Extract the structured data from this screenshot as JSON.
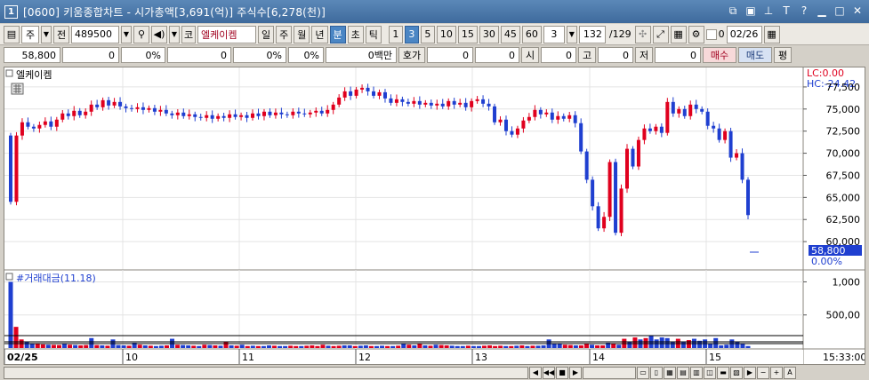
{
  "window": {
    "window_number": "1",
    "title": "[0600] 키움종합차트 - 시가총액[3,691(억)] 주식수[6,278(천)]"
  },
  "toolbar": {
    "period_select": "주",
    "prev_label": "전",
    "stock_code": "489500",
    "market_label": "코",
    "stock_name": "엘케이켐",
    "tf_day": "일",
    "tf_week": "주",
    "tf_month": "월",
    "tf_year": "년",
    "tf_minute": "분",
    "tf_second": "초",
    "tf_tick": "틱",
    "intervals": [
      "1",
      "3",
      "5",
      "10",
      "15",
      "30",
      "45",
      "60"
    ],
    "interval_value": "3",
    "bar_count": "132",
    "bar_total": "/129",
    "checkbox_count": "0",
    "date_value": "02/26"
  },
  "info": {
    "price": "58,800",
    "change": "0",
    "change_pct": "0%",
    "volume": "0",
    "volume_pct": "0%",
    "pct3": "0%",
    "amount": "0백만",
    "quote_label": "호가",
    "quote_bid": "0",
    "quote_ask": "0",
    "open_label": "시",
    "open": "0",
    "high_label": "고",
    "high": "0",
    "low_label": "저",
    "low": "0",
    "buy_label": "매수",
    "sell_label": "매도",
    "avg_label": "평"
  },
  "chart_title": "엘케이켐",
  "lc_label": "LC:0.00",
  "hc_label": "HC:-24.42",
  "current_price_tag": "58,800",
  "current_pct_tag": "0.00%",
  "volume_title": "#거래대금(11.18)",
  "time_label": "15:33:00",
  "colors": {
    "up": "#e0001e",
    "down": "#1f3fd0",
    "price_tag": "#1f3fd0"
  },
  "chart_data": {
    "type": "candlestick",
    "price_axis": {
      "ticks": [
        77500,
        75000,
        72500,
        70000,
        67500,
        65000,
        62500,
        60000
      ],
      "labels": [
        "77,500",
        "75,000",
        "72,500",
        "70,000",
        "67,500",
        "65,000",
        "62,500",
        "60,000"
      ],
      "range": [
        57000,
        79500
      ]
    },
    "volume_axis": {
      "ticks": [
        1000,
        500
      ],
      "labels": [
        "1,000",
        "500,00"
      ],
      "range": [
        0,
        1100
      ]
    },
    "date_labels": [
      "02/25",
      "10",
      "11",
      "12",
      "13",
      "14",
      "15"
    ],
    "volume_bars": [
      1000,
      320,
      130,
      100,
      70,
      60,
      55,
      50,
      48,
      45,
      60,
      50,
      45,
      40,
      45,
      150,
      45,
      40,
      35,
      130,
      45,
      40,
      35,
      80,
      50,
      40,
      35,
      30,
      35,
      40,
      140,
      50,
      45,
      40,
      35,
      30,
      50,
      45,
      40,
      35,
      100,
      40,
      35,
      50,
      30,
      35,
      30,
      30,
      40,
      35,
      30,
      30,
      35,
      30,
      30,
      35,
      40,
      30,
      50,
      35,
      30,
      35,
      40,
      40,
      30,
      35,
      40,
      30,
      30,
      35,
      30,
      30,
      35,
      70,
      50,
      40,
      60,
      40,
      35,
      50,
      45,
      40,
      35,
      30,
      30,
      35,
      30,
      30,
      35,
      40,
      30,
      35,
      30,
      30,
      35,
      40,
      30,
      35,
      35,
      40,
      130,
      70,
      60,
      50,
      45,
      40,
      40,
      60,
      50,
      40,
      40,
      80,
      60,
      50,
      140,
      100,
      160,
      130,
      150,
      190,
      130,
      160,
      150,
      100,
      140,
      100,
      120,
      140,
      110,
      130,
      70,
      150,
      40,
      50,
      130,
      90,
      60,
      30
    ]
  }
}
